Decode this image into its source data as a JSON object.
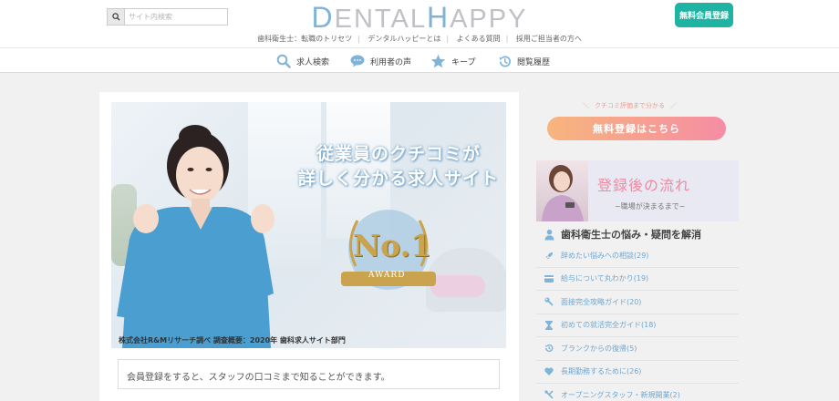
{
  "header": {
    "search_placeholder": "サイト内検索",
    "logo_parts": [
      "D",
      "ENTAL",
      "H",
      "APPY"
    ],
    "subnav": [
      "歯科衛生士：転職のトリセツ",
      "デンタルハッピーとは",
      "よくある質問",
      "採用ご担当者の方へ"
    ],
    "register_button": "無料会員登録",
    "colors": {
      "brand_teal": "#1fb3a3",
      "logo_blue": "#7fb4d8",
      "logo_gray": "#bfc1c6"
    }
  },
  "nav": {
    "items": [
      {
        "label": "求人検索",
        "icon": "search-icon"
      },
      {
        "label": "利用者の声",
        "icon": "speech-bubble-icon"
      },
      {
        "label": "キープ",
        "icon": "star-icon"
      },
      {
        "label": "閲覧履歴",
        "icon": "history-icon"
      }
    ]
  },
  "hero": {
    "title_line1": "従業員のクチコミが",
    "title_line2": "詳しく分かる求人サイト",
    "badge_main": "No.1",
    "badge_sub": "AWARD",
    "caption": "株式会社R&Mリサーチ調べ 調査概要：2020年 歯科求人サイト部門"
  },
  "notice": "会員登録をすると、スタッフの口コミまで知ることができます。",
  "sidebar": {
    "tagline": "クチコミ評価まで分かる",
    "free_register": "無料登録はこちら",
    "flow_title": "登録後の流れ",
    "flow_sub": "~職場が決まるまで~",
    "section_title": "歯科衛生士の悩み・疑問を解消",
    "items": [
      {
        "label": "辞めたい悩みへの相談(29)",
        "icon": "rocket-icon"
      },
      {
        "label": "給与について丸わかり(19)",
        "icon": "wallet-icon"
      },
      {
        "label": "面接完全攻略ガイド(20)",
        "icon": "wrench-icon"
      },
      {
        "label": "初めての就活完全ガイド(18)",
        "icon": "hourglass-icon"
      },
      {
        "label": "ブランクからの復帰(5)",
        "icon": "history-icon"
      },
      {
        "label": "長期勤務するために(26)",
        "icon": "heart-icon"
      },
      {
        "label": "オープニングスタッフ・新規開業(2)",
        "icon": "tools-icon"
      }
    ]
  }
}
